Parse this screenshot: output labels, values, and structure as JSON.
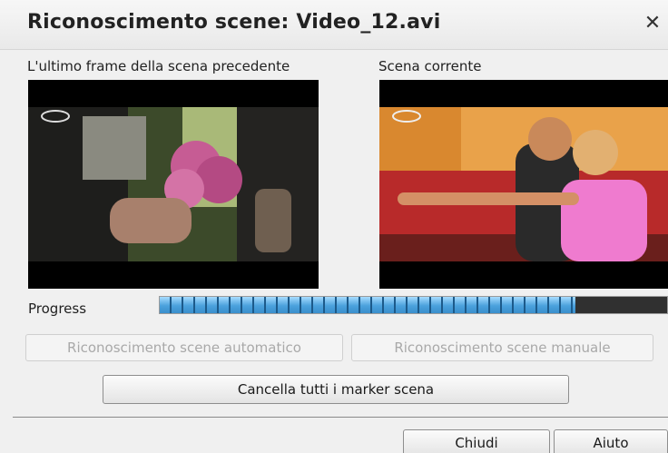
{
  "window": {
    "title": "Riconoscimento scene: Video_12.avi",
    "close_label": "✕"
  },
  "frames": {
    "previous_label": "L'ultimo frame della scena precedente",
    "current_label": "Scena corrente"
  },
  "progress": {
    "label": "Progress",
    "fraction": 0.82
  },
  "buttons": {
    "auto": "Riconoscimento scene automatico",
    "manual": "Riconoscimento scene manuale",
    "clear": "Cancella tutti i marker scena",
    "close": "Chiudi",
    "help": "Aiuto"
  },
  "colors": {
    "progress_fill": "#5fb0e4",
    "progress_track": "#303030"
  }
}
